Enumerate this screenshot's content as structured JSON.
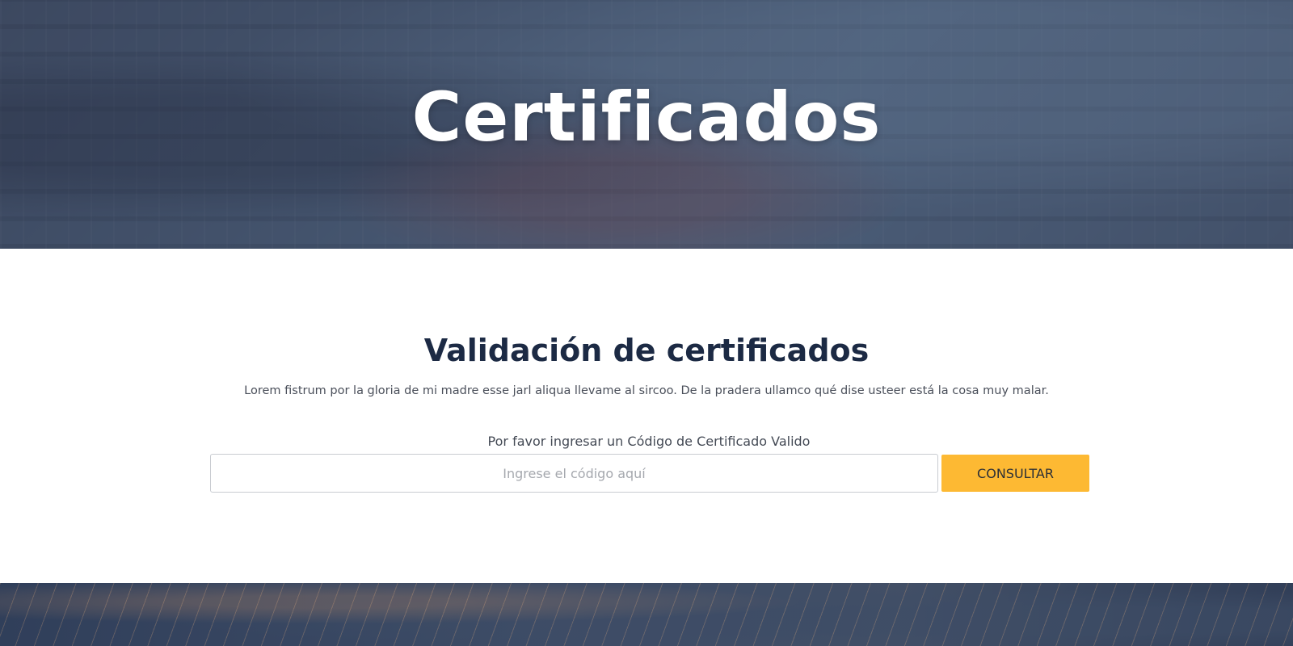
{
  "hero": {
    "title": "Certificados"
  },
  "validation": {
    "title": "Validación de certificados",
    "description": "Lorem fistrum por la gloria de mi madre esse jarl aliqua llevame al sircoo. De la pradera ullamco qué dise usteer está la cosa muy malar.",
    "field_label": "Por favor ingresar un Código de Certificado Valido",
    "input_placeholder": "Ingrese el código aquí",
    "input_value": "",
    "button_label": "CONSULTAR"
  },
  "colors": {
    "accent": "#fdb933",
    "heading": "#1c2a44",
    "hero_overlay": "#22304c"
  }
}
